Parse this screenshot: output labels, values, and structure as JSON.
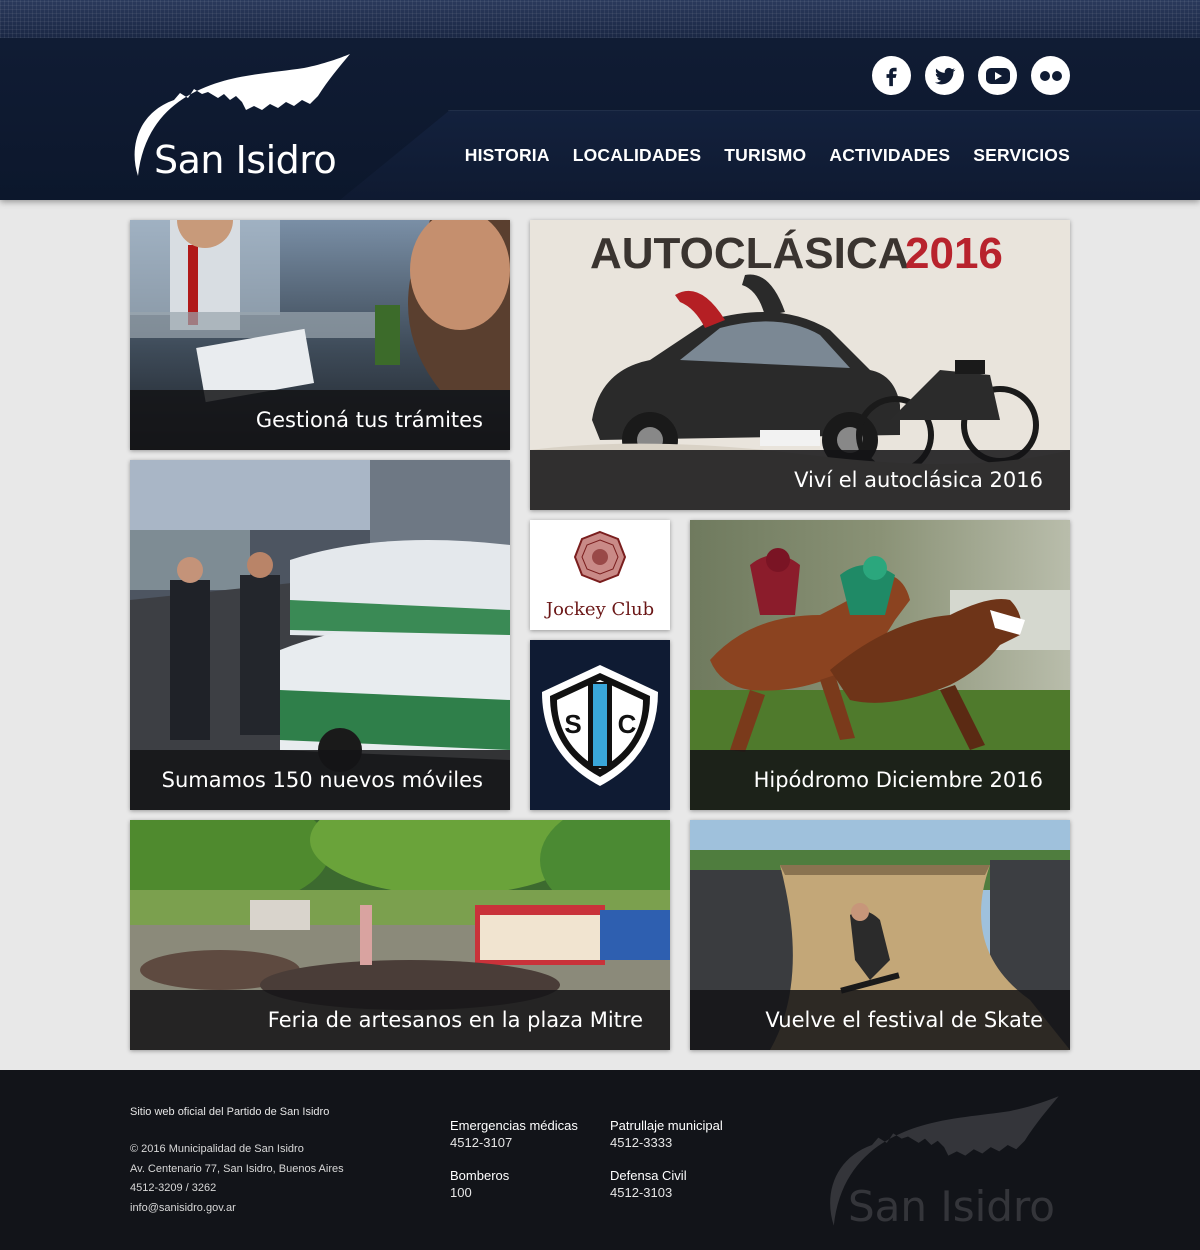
{
  "brand": {
    "name": "San Isidro"
  },
  "social": [
    {
      "icon": "facebook-icon",
      "glyph": "f"
    },
    {
      "icon": "twitter-icon",
      "glyph": "t"
    },
    {
      "icon": "youtube-icon",
      "glyph": "yt"
    },
    {
      "icon": "flickr-icon",
      "glyph": "fl"
    }
  ],
  "nav": {
    "historia": "HISTORIA",
    "localidades": "LOCALIDADES",
    "turismo": "TURISMO",
    "actividades": "ACTIVIDADES",
    "servicios": "SERVICIOS"
  },
  "tiles": {
    "tramites": "Gestioná tus trámites",
    "autoclasica": "Viví el autoclásica 2016",
    "moviles": "Sumamos 150 nuevos móviles",
    "hipodromo": "Hipódromo Diciembre 2016",
    "feria": "Feria de artesanos en la plaza Mitre",
    "skate": "Vuelve el festival de Skate"
  },
  "promo": {
    "autoclasica_title": "AUTOCLÁSICA",
    "autoclasica_year": "2016",
    "jockey_club": "Jockey Club",
    "sic_letters": "SIC"
  },
  "footer": {
    "official": "Sitio web oficial del Partido de San Isidro",
    "copyright": "© 2016 Municipalidad de San Isidro",
    "address": "Av. Centenario 77, San Isidro, Buenos Aires",
    "phone": "4512-3209 / 3262",
    "email": "info@sanisidro.gov.ar",
    "contacts": [
      {
        "label": "Emergencias médicas",
        "number": "4512-3107"
      },
      {
        "label": "Patrullaje municipal",
        "number": "4512-3333"
      },
      {
        "label": "Bomberos",
        "number": "100"
      },
      {
        "label": "Defensa Civil",
        "number": "4512-3103"
      }
    ]
  },
  "colors": {
    "header_navy": "#0f1b33",
    "page_bg": "#e8e8e8",
    "footer_bg": "#121419",
    "caption_bg": "#141416",
    "autoclasica_red": "#b8232d"
  }
}
